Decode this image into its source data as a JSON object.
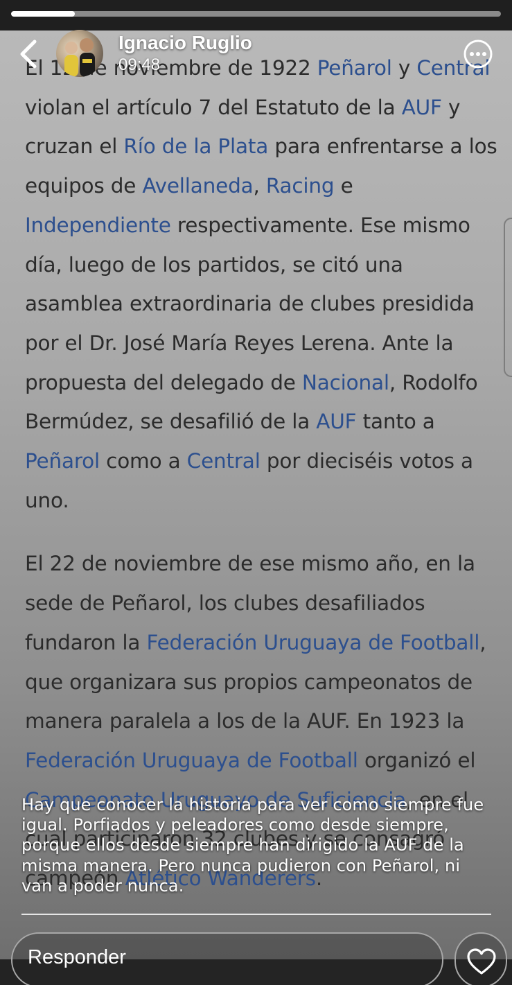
{
  "story": {
    "progress_percent": 13,
    "author_name": "Ignacio Ruglio",
    "post_time": "09:48"
  },
  "article": {
    "paragraph1": [
      {
        "text": "El 12 de noviembre de 1922 "
      },
      {
        "text": "Peñarol",
        "link": true
      },
      {
        "text": " y "
      },
      {
        "text": "Central",
        "link": true
      },
      {
        "text": " violan el artículo 7 del Estatuto de la "
      },
      {
        "text": "AUF",
        "link": true
      },
      {
        "text": " y cruzan el "
      },
      {
        "text": "Río de la Plata",
        "link": true
      },
      {
        "text": " para enfrentarse a los equipos de "
      },
      {
        "text": "Avellaneda",
        "link": true
      },
      {
        "text": ", "
      },
      {
        "text": "Racing",
        "link": true
      },
      {
        "text": " e "
      },
      {
        "text": "Independiente",
        "link": true
      },
      {
        "text": " respectivamente. Ese mismo día, luego de los partidos, se citó una asamblea extraordinaria de clubes presidida por el Dr. José María Reyes Lerena. Ante la propuesta del delegado de "
      },
      {
        "text": "Nacional",
        "link": true
      },
      {
        "text": ", Rodolfo Bermúdez, se desafilió de la "
      },
      {
        "text": "AUF",
        "link": true
      },
      {
        "text": " tanto a "
      },
      {
        "text": "Peñarol",
        "link": true
      },
      {
        "text": " como a "
      },
      {
        "text": "Central",
        "link": true
      },
      {
        "text": " por dieciséis votos a uno."
      }
    ],
    "paragraph2": [
      {
        "text": "El 22 de noviembre de ese mismo año, en la sede de Peñarol, los clubes desafiliados fundaron la "
      },
      {
        "text": "Federación Uruguaya de Football",
        "link": true
      },
      {
        "text": ", que organizara sus propios campeonatos de manera paralela a los de la AUF. En 1923 la "
      },
      {
        "text": "Federación Uruguaya de Football",
        "link": true
      },
      {
        "text": " organizó el "
      },
      {
        "text": "Campeonato Uruguayo de Suficiencia",
        "link": true
      },
      {
        "text": ", en el cual participaron 32 clubes y se consagró campeón "
      },
      {
        "text": "Atlético Wanderers",
        "link": true
      },
      {
        "text": "."
      }
    ]
  },
  "caption": "Hay que conocer la historia para ver como siempre fue igual. Porfiados y peleadores como desde siempre, porque ellos desde siempre han dirigido la AUF de la misma manera. Pero nunca pudieron con Peñarol, ni van a poder nunca.",
  "reply": {
    "placeholder": "Responder"
  },
  "icons": {
    "back": "chevron-left-icon",
    "more": "more-options-icon",
    "like": "heart-icon"
  },
  "colors": {
    "link": "#2c4f8e",
    "article_text": "#2b2b2b",
    "progress_fill": "#ffffff"
  }
}
